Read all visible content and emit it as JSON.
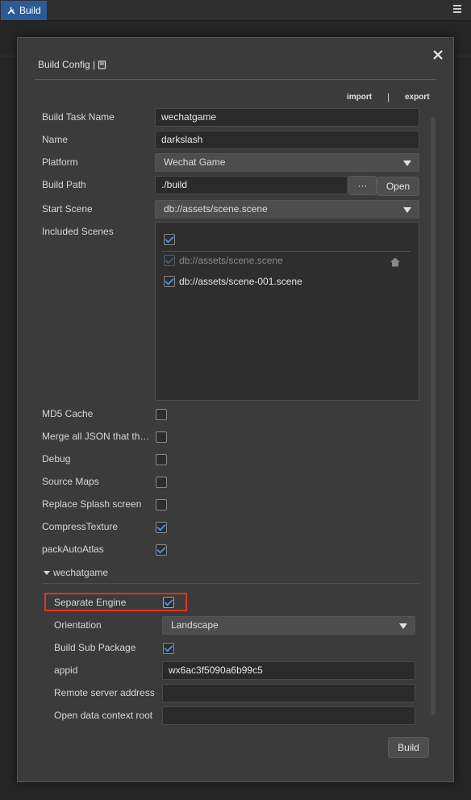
{
  "topbar": {
    "tab_label": "Build"
  },
  "dialog": {
    "title": "Build Config |",
    "import_label": "import",
    "separator": "|",
    "export_label": "export",
    "build_button": "Build"
  },
  "form": {
    "build_task_name": {
      "label": "Build Task Name",
      "value": "wechatgame"
    },
    "name": {
      "label": "Name",
      "value": "darkslash"
    },
    "platform": {
      "label": "Platform",
      "value": "Wechat Game"
    },
    "build_path": {
      "label": "Build Path",
      "value": "./build",
      "browse": "···",
      "open": "Open"
    },
    "start_scene": {
      "label": "Start Scene",
      "value": "db://assets/scene.scene"
    },
    "included_scenes": {
      "label": "Included Scenes",
      "select_all_checked": true,
      "items": [
        {
          "path": "db://assets/scene.scene",
          "checked": true,
          "disabled": true
        },
        {
          "path": "db://assets/scene-001.scene",
          "checked": true,
          "disabled": false
        }
      ]
    },
    "options": [
      {
        "label": "MD5 Cache",
        "checked": false
      },
      {
        "label": "Merge all JSON that th…",
        "checked": false
      },
      {
        "label": "Debug",
        "checked": false
      },
      {
        "label": "Source Maps",
        "checked": false
      },
      {
        "label": "Replace Splash screen",
        "checked": false
      },
      {
        "label": "CompressTexture",
        "checked": true
      },
      {
        "label": "packAutoAtlas",
        "checked": true
      }
    ]
  },
  "wechat": {
    "section_title": "wechatgame",
    "separate_engine": {
      "label": "Separate Engine",
      "checked": true
    },
    "orientation": {
      "label": "Orientation",
      "value": "Landscape"
    },
    "build_sub_package": {
      "label": "Build Sub Package",
      "checked": true
    },
    "appid": {
      "label": "appid",
      "value": "wx6ac3f5090a6b99c5"
    },
    "remote_server": {
      "label": "Remote server address",
      "value": ""
    },
    "open_data_root": {
      "label": "Open data context root",
      "value": ""
    }
  },
  "colors": {
    "accent": "#2a5b96",
    "check": "#4f8ad6",
    "highlight": "#e0361f"
  }
}
